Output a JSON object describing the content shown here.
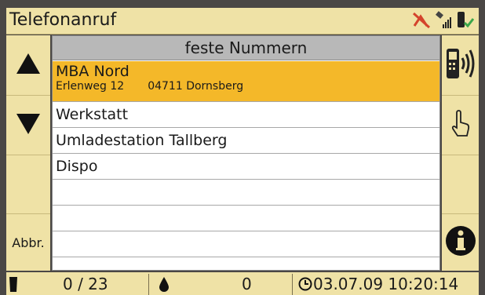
{
  "title": "Telefonanruf",
  "status_icons": [
    "gps-off-icon",
    "satellite-signal-icon",
    "phone-connected-icon"
  ],
  "list": {
    "header": "feste Nummern",
    "rows": [
      {
        "name": "MBA Nord",
        "street": "Erlenweg 12",
        "city": "04711 Dornsberg",
        "selected": true
      },
      {
        "name": "Werkstatt"
      },
      {
        "name": "Umladestation Tallberg"
      },
      {
        "name": "Dispo"
      }
    ]
  },
  "left_buttons": {
    "up_icon": "arrow-up-icon",
    "down_icon": "arrow-down-icon",
    "abort_label": "Abbr."
  },
  "right_buttons": {
    "call_icon": "phone-call-icon",
    "select_icon": "hand-pointer-icon",
    "info_icon": "info-icon"
  },
  "footer": {
    "counter": "0 / 23",
    "level": "0",
    "datetime": "03.07.09 10:20:14"
  },
  "colors": {
    "panel": "#efe2a6",
    "selected_row": "#f4b829",
    "header": "#b8b8b8"
  }
}
